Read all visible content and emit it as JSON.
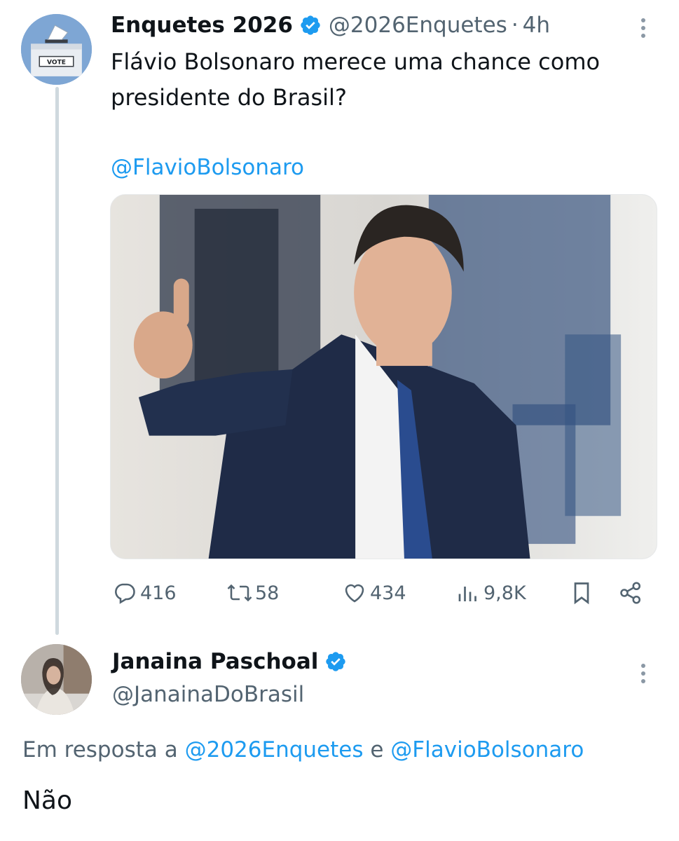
{
  "parent_tweet": {
    "avatar_label": "VOTE",
    "author_name": "Enquetes 2026",
    "handle": "@2026Enquetes",
    "separator": "·",
    "time": "4h",
    "text": "Flávio Bolsonaro merece uma chance como presidente do Brasil?",
    "mention": "@FlavioBolsonaro",
    "media": "photo of a man in a navy suit giving a thumbs up",
    "stats": {
      "replies": "416",
      "reposts": "58",
      "likes": "434",
      "views": "9,8K"
    }
  },
  "reply_tweet": {
    "author_name": "Janaina Paschoal",
    "handle": "@JanainaDoBrasil",
    "in_reply_to_prefix": "Em resposta a",
    "in_reply_to_user1": "@2026Enquetes",
    "in_reply_to_conj": "e",
    "in_reply_to_user2": "@FlavioBolsonaro",
    "text": "Não"
  },
  "colors": {
    "accent": "#1d9bf0",
    "secondary_text": "#536471",
    "verified_badge": "#1d9bf0"
  },
  "icons": [
    "more-icon",
    "verified-icon",
    "reply-icon",
    "repost-icon",
    "like-icon",
    "views-icon",
    "bookmark-icon",
    "share-icon"
  ]
}
